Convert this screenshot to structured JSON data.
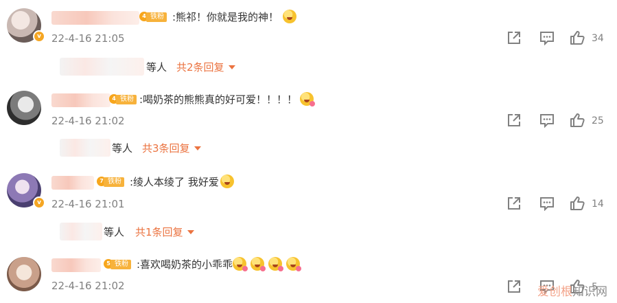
{
  "comments": [
    {
      "badge": "铁粉",
      "badge_level": "4",
      "text": ":熊祁！你就是我的神！",
      "emojis": 1,
      "time": "22-4-16 21:05",
      "likes": "34",
      "reply_suffix": "等人",
      "reply_more": "共2条回复"
    },
    {
      "badge": "铁粉",
      "badge_level": "4",
      "text": ":喝奶茶的熊熊真的好可爱！！！！",
      "emojis": 1,
      "time": "22-4-16 21:02",
      "likes": "25",
      "reply_suffix": "等人",
      "reply_more": "共3条回复"
    },
    {
      "badge": "铁粉",
      "badge_level": "7",
      "text": ":绫人本绫了 我好爱",
      "emojis": 1,
      "time": "22-4-16 21:01",
      "likes": "14",
      "reply_suffix": "等人",
      "reply_more": "共1条回复"
    },
    {
      "badge": "铁粉",
      "badge_level": "5",
      "text": ":喜欢喝奶茶的小乖乖",
      "emojis": 4,
      "time": "22-4-16 21:02",
      "likes": "5"
    }
  ],
  "watermark": {
    "part1": "爱创根",
    "part2": "知识网"
  },
  "icons": [
    "share-icon",
    "comment-icon",
    "like-icon"
  ],
  "colors": {
    "accent": "#eb7340",
    "badge": "#f7b23b",
    "muted": "#808080"
  }
}
